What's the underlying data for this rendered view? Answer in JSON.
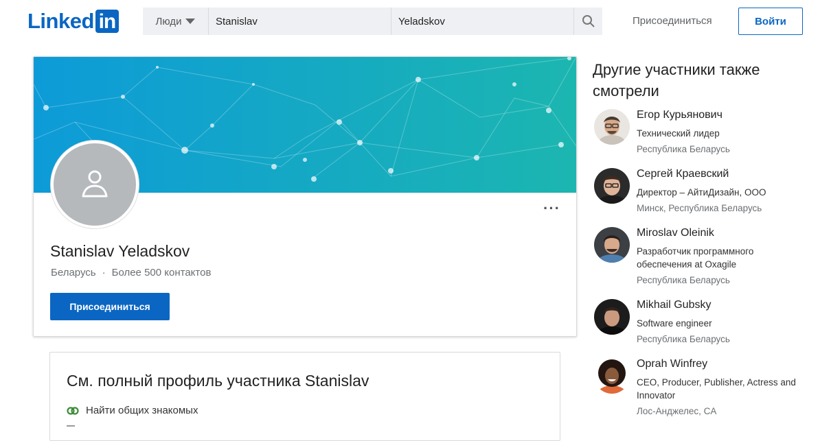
{
  "header": {
    "logo_word": "Linked",
    "logo_box": "in",
    "search": {
      "category": "Люди",
      "first_name": "Stanislav",
      "last_name": "Yeladskov",
      "search_icon": "search-icon"
    },
    "join_label": "Присоединиться",
    "login_label": "Войти"
  },
  "profile": {
    "name": "Stanislav Yeladskov",
    "location": "Беларусь",
    "separator": "·",
    "connections": "Более 500 контактов",
    "join_button": "Присоединиться",
    "more_label": "···",
    "avatar_icon": "person-placeholder-icon"
  },
  "full_profile": {
    "title": "См. полный профиль участника Stanislav",
    "features": [
      {
        "label": "Найти общих знакомых",
        "icon": "mutual-connections-icon"
      }
    ]
  },
  "sidebar": {
    "title": "Другие участники также смотрели",
    "members": [
      {
        "name": "Егор Курьянович",
        "role": "Технический лидер",
        "location": "Республика Беларусь"
      },
      {
        "name": "Сергей Краевский",
        "role": "Директор – АйтиДизайн, ООО",
        "location": "Минск, Республика Беларусь"
      },
      {
        "name": "Miroslav Oleinik",
        "role": "Разработчик программного обеспечения at Oxagile",
        "location": "Республика Беларусь"
      },
      {
        "name": "Mikhail Gubsky",
        "role": "Software engineer",
        "location": "Республика Беларусь"
      },
      {
        "name": "Oprah Winfrey",
        "role": "CEO, Producer, Publisher, Actress and Innovator",
        "location": "Лос-Анджелес, CA"
      }
    ]
  },
  "colors": {
    "brand_blue": "#0a66c2",
    "banner_from": "#0f9fd6",
    "banner_to": "#19b3b0"
  }
}
